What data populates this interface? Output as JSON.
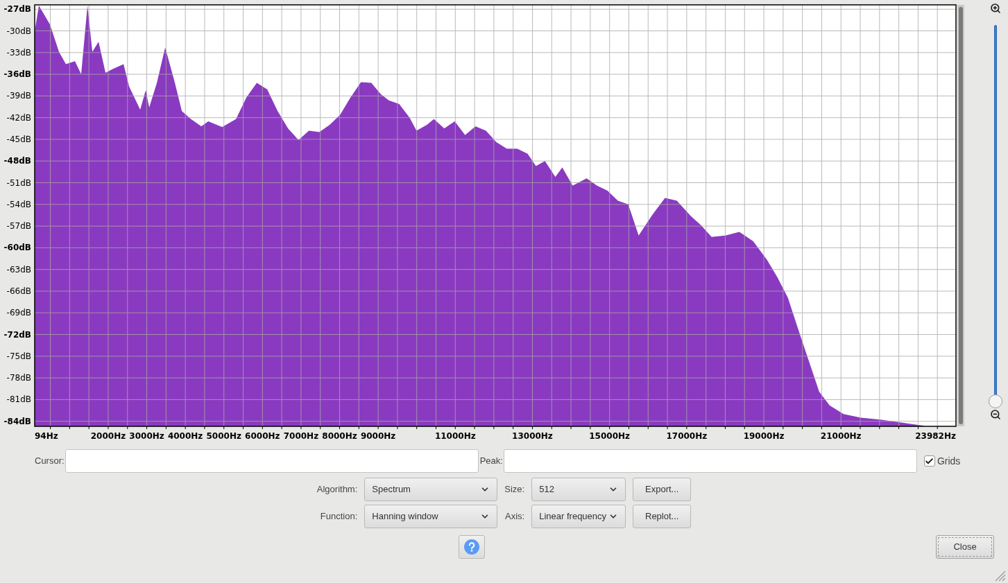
{
  "spectrum": {
    "chart_data": {
      "type": "area",
      "grid": true,
      "xlim": [
        94,
        23982
      ],
      "ylim": [
        -84.7,
        -26.4
      ],
      "xticks": [
        {
          "value": 94,
          "label": "94Hz"
        },
        {
          "value": 2000,
          "label": "2000Hz"
        },
        {
          "value": 3000,
          "label": "3000Hz"
        },
        {
          "value": 4000,
          "label": "4000Hz"
        },
        {
          "value": 5000,
          "label": "5000Hz"
        },
        {
          "value": 6000,
          "label": "6000Hz"
        },
        {
          "value": 7000,
          "label": "7000Hz"
        },
        {
          "value": 8000,
          "label": "8000Hz"
        },
        {
          "value": 9000,
          "label": "9000Hz"
        },
        {
          "value": 11000,
          "label": "11000Hz"
        },
        {
          "value": 13000,
          "label": "13000Hz"
        },
        {
          "value": 15000,
          "label": "15000Hz"
        },
        {
          "value": 17000,
          "label": "17000Hz"
        },
        {
          "value": 19000,
          "label": "19000Hz"
        },
        {
          "value": 21000,
          "label": "21000Hz"
        },
        {
          "value": 23982,
          "label": "23982Hz"
        }
      ],
      "yticks": [
        {
          "value": -27,
          "label": "-27dB"
        },
        {
          "value": -30,
          "label": "-30dB"
        },
        {
          "value": -33,
          "label": "-33dB"
        },
        {
          "value": -36,
          "label": "-36dB"
        },
        {
          "value": -39,
          "label": "-39dB"
        },
        {
          "value": -42,
          "label": "-42dB"
        },
        {
          "value": -45,
          "label": "-45dB"
        },
        {
          "value": -48,
          "label": "-48dB"
        },
        {
          "value": -51,
          "label": "-51dB"
        },
        {
          "value": -54,
          "label": "-54dB"
        },
        {
          "value": -57,
          "label": "-57dB"
        },
        {
          "value": -60,
          "label": "-60dB"
        },
        {
          "value": -63,
          "label": "-63dB"
        },
        {
          "value": -66,
          "label": "-66dB"
        },
        {
          "value": -69,
          "label": "-69dB"
        },
        {
          "value": -72,
          "label": "-72dB"
        },
        {
          "value": -75,
          "label": "-75dB"
        },
        {
          "value": -78,
          "label": "-78dB"
        },
        {
          "value": -81,
          "label": "-81dB"
        },
        {
          "value": -84,
          "label": "-84dB"
        }
      ],
      "x": [
        94,
        202,
        490,
        724,
        904,
        1138,
        1300,
        1462,
        1588,
        1750,
        1930,
        2110,
        2398,
        2542,
        2830,
        2974,
        3064,
        3262,
        3478,
        3730,
        3910,
        4144,
        4414,
        4594,
        4954,
        5314,
        5584,
        5854,
        6124,
        6394,
        6664,
        6934,
        7204,
        7474,
        7744,
        8014,
        8284,
        8554,
        8824,
        9058,
        9274,
        9544,
        9814,
        9994,
        10264,
        10444,
        10714,
        10984,
        11254,
        11524,
        11794,
        12064,
        12334,
        12604,
        12874,
        13090,
        13324,
        13594,
        13774,
        14044,
        14404,
        14674,
        14944,
        15214,
        15484,
        15754,
        16114,
        16438,
        16744,
        17104,
        17374,
        17644,
        18004,
        18364,
        18724,
        19084,
        19354,
        19624,
        19894,
        20164,
        20434,
        20704,
        21064,
        21514,
        22054,
        22594,
        23134
      ],
      "series": [
        {
          "color": "#8a3ac0",
          "values": [
            -30.1,
            -26.5,
            -29.1,
            -32.9,
            -34.6,
            -34.2,
            -36.0,
            -26.5,
            -32.9,
            -31.5,
            -35.8,
            -35.3,
            -34.6,
            -37.7,
            -40.9,
            -38.2,
            -40.6,
            -37.2,
            -32.3,
            -37.2,
            -41.1,
            -42.2,
            -43.2,
            -42.5,
            -43.3,
            -42.2,
            -39.2,
            -37.2,
            -38.1,
            -41.1,
            -43.5,
            -45.1,
            -43.8,
            -44.0,
            -43.0,
            -41.6,
            -39.2,
            -37.1,
            -37.2,
            -38.7,
            -39.6,
            -40.1,
            -42.0,
            -43.8,
            -43.0,
            -42.2,
            -43.5,
            -42.5,
            -44.4,
            -43.2,
            -43.8,
            -45.4,
            -46.3,
            -46.3,
            -47.0,
            -48.7,
            -48.0,
            -50.2,
            -48.9,
            -51.4,
            -50.4,
            -51.4,
            -52.1,
            -53.5,
            -54.0,
            -58.3,
            -55.4,
            -53.1,
            -53.5,
            -55.6,
            -56.9,
            -58.5,
            -58.3,
            -57.8,
            -59.1,
            -61.7,
            -64.1,
            -66.9,
            -71.3,
            -75.6,
            -79.9,
            -81.8,
            -83.0,
            -83.5,
            -83.8,
            -84.2,
            -84.6
          ]
        }
      ]
    }
  },
  "zoom_slider": {
    "level": 0
  },
  "cursor_field": {
    "label": "Cursor:"
  },
  "peak_field": {
    "label": "Peak:"
  },
  "grids_checkbox": {
    "label": "Grids",
    "checked": true
  },
  "controls": [
    {
      "label": "Algorithm:",
      "value": "Spectrum"
    },
    {
      "label": "Size:",
      "value": "512"
    },
    {
      "label": "Function:",
      "value": "Hanning window"
    },
    {
      "label": "Axis:",
      "value": "Linear frequency"
    }
  ],
  "buttons": [
    "Export...",
    "Replot..."
  ],
  "close_button": "Close"
}
